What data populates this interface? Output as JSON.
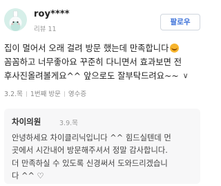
{
  "review": {
    "username": "roy****",
    "review_count": "리뷰 11",
    "follow_label": "팔로우",
    "body_lines": [
      "집이 멀어서 오래 걸려 방문 했는데 만족합니다",
      "꼼꼼하고 너무좋아요 꾸준히 다니면서 효과보면 전",
      "후사진올려볼게요^^ 앞으로도 잘부탁드려요~~"
    ],
    "emoji": "smiling-face-emoji",
    "more_icon": "chevron-down-icon",
    "more_glyph": "∨",
    "meta": {
      "date": "3.2.목",
      "visit": "1번째 방문",
      "receipt": "영수증"
    }
  },
  "reply": {
    "name": "차이의원",
    "date": "3.9.목",
    "lines": [
      "안녕하세요 차이클리닉입니다 ^^ 힘드실텐데 먼",
      "곳에서 시간내어 방문해주셔서 정말 감사합니다.",
      "더 만족하실 수 있도록 신경써서 도와드리겠습니",
      "다 ^^ ♡"
    ]
  },
  "colors": {
    "follow_text": "#3a6fd8",
    "reply_background": "#f7f7f8",
    "avatar_background": "#d6efe9"
  }
}
